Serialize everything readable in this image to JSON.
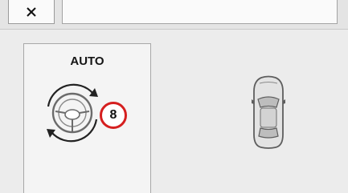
{
  "toolbar": {
    "close_icon": "close-icon",
    "field_value": ""
  },
  "drive_mode": {
    "label": "AUTO",
    "icon": "steering-wheel-rotate-icon",
    "speed_limit": "8",
    "badge_color": "#d51f1f"
  },
  "vehicle": {
    "icon": "car-top-view-icon"
  }
}
